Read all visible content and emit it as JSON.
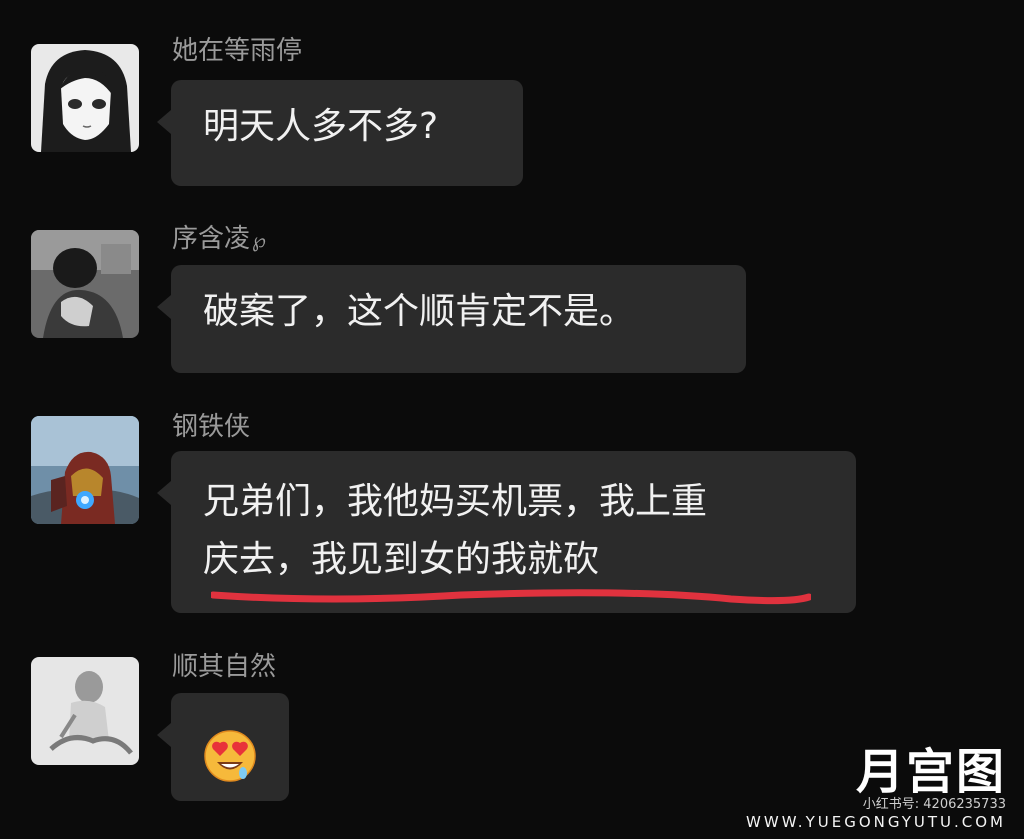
{
  "messages": [
    {
      "sender": "她在等雨停",
      "lines": [
        "明天人多不多?"
      ]
    },
    {
      "sender": "序含凌",
      "sender_symbol": "℘",
      "lines": [
        "破案了，这个顺肯定不是。"
      ]
    },
    {
      "sender": "钢铁侠",
      "lines": [
        "兄弟们，我他妈买机票，我上重",
        "庆去，我见到女的我就砍"
      ],
      "underline_color": "#e0323e"
    },
    {
      "sender": "顺其自然",
      "emoji": "smiling-face-with-heart-eyes-emoji"
    }
  ],
  "watermark": {
    "logo": "月宫图",
    "id_line": "小红书号: 4206235733",
    "site": "WWW.YUEGONGYUTU.COM"
  },
  "colors": {
    "background": "#0b0b0b",
    "bubble": "#2b2b2b",
    "sender_name": "#9a9a9a",
    "text": "#f1f1f1",
    "underline": "#e0323e"
  }
}
